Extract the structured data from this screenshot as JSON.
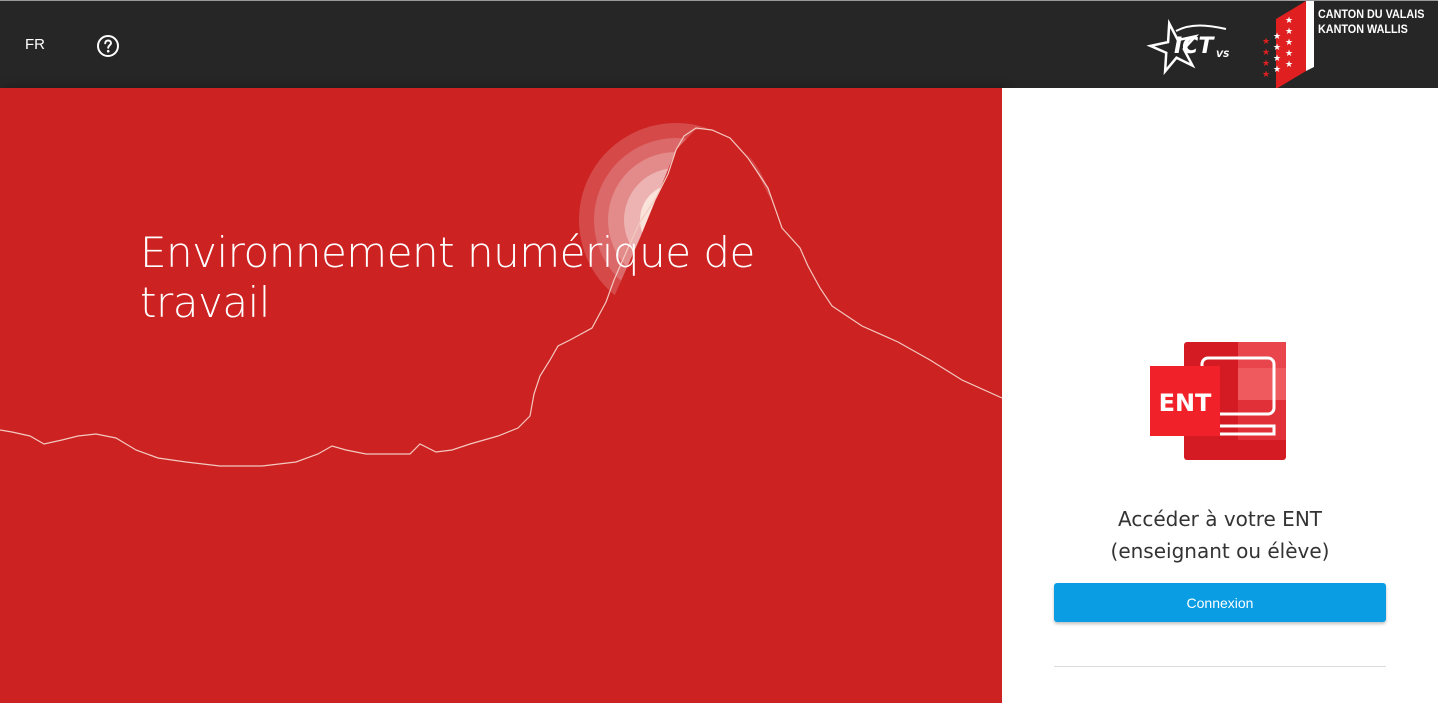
{
  "header": {
    "language": "FR",
    "help_icon": "help-circle-icon",
    "ict_logo": {
      "main": "ICT",
      "sub": "VS"
    },
    "canton": {
      "line1": "CANTON DU VALAIS",
      "line2": "KANTON WALLIS"
    }
  },
  "hero": {
    "title_line1": "Environnement numérique de",
    "title_line2": "travail",
    "background_color": "#cc2222"
  },
  "login_panel": {
    "app_icon_label": "ENT",
    "access_line1": "Accéder à votre ENT",
    "access_line2": "(enseignant ou élève)",
    "connect_button": "Connexion",
    "button_color": "#0a9de4"
  }
}
